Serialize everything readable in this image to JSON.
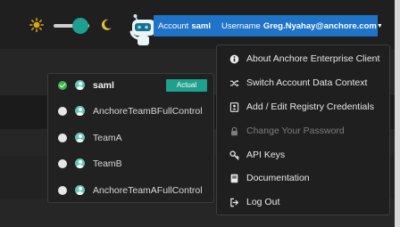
{
  "header": {
    "theme_toggle": {
      "light_icon": "sun-icon",
      "dark_icon": "moon-icon"
    },
    "mascot_icon": "robot-icon",
    "account_label": "Account",
    "account_value": "saml",
    "username_label": "Username",
    "username_value": "Greg.Nyahay@anchore.com"
  },
  "context_menu": {
    "items": [
      {
        "label": "saml",
        "checked": true,
        "badge": "Actual"
      },
      {
        "label": "AnchoreTeamBFullControl",
        "checked": false
      },
      {
        "label": "TeamA",
        "checked": false
      },
      {
        "label": "TeamB",
        "checked": false
      },
      {
        "label": "AnchoreTeamAFullControl",
        "checked": false
      }
    ]
  },
  "user_menu": {
    "items": [
      {
        "label": "About Anchore Enterprise Client",
        "icon": "info-circle-icon",
        "enabled": true
      },
      {
        "label": "Switch Account Data Context",
        "icon": "shuffle-icon",
        "enabled": true
      },
      {
        "label": "Add / Edit Registry Credentials",
        "icon": "id-card-icon",
        "enabled": true
      },
      {
        "label": "Change Your Password",
        "icon": "lock-icon",
        "enabled": false
      },
      {
        "label": "API Keys",
        "icon": "key-icon",
        "enabled": true
      },
      {
        "label": "Documentation",
        "icon": "book-icon",
        "enabled": true
      },
      {
        "label": "Log Out",
        "icon": "logout-icon",
        "enabled": true
      }
    ]
  },
  "colors": {
    "accent_blue": "#1f73c8",
    "accent_teal": "#1ea08f",
    "sun": "#d9a617",
    "moon": "#e4c13a",
    "check_green": "#3db54a"
  }
}
